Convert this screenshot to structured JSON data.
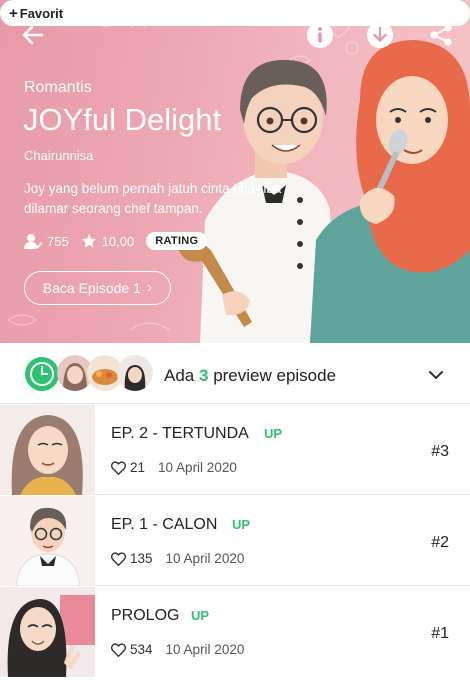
{
  "header": {
    "favorite_label": "Favorit",
    "favorite_plus": "+"
  },
  "comic": {
    "genre": "Romantis",
    "title": "JOYful Delight",
    "author": "Chairunnisa",
    "synopsis": "Joy yang belum pernah jatuh cinta tiba-tiba dilamar seorang chef tampan.",
    "subscribers": "755",
    "rating_value": "10,00",
    "rating_label": "RATING",
    "read_button": "Baca Episode 1",
    "read_button_chevron": "›"
  },
  "preview": {
    "prefix": "Ada",
    "count": "3",
    "suffix": "preview episode"
  },
  "episodes": [
    {
      "title": "EP. 2 - TERTUNDA",
      "badge": "UP",
      "likes": "21",
      "date": "10 April 2020",
      "number": "#3"
    },
    {
      "title": "EP. 1 - CALON",
      "badge": "UP",
      "likes": "135",
      "date": "10 April 2020",
      "number": "#2"
    },
    {
      "title": "PROLOG",
      "badge": "UP",
      "likes": "534",
      "date": "10 April 2020",
      "number": "#1"
    }
  ],
  "icons": {
    "back": "back-arrow-icon",
    "info": "info-icon",
    "download": "download-icon",
    "share": "share-icon",
    "subscribers": "person-check-icon",
    "rating": "star-icon",
    "clock": "clock-icon",
    "chevron": "chevron-down-icon",
    "likes": "heart-icon"
  },
  "colors": {
    "accent": "#2ec373",
    "hero_pink": "#e79aa8",
    "text": "#222222"
  }
}
